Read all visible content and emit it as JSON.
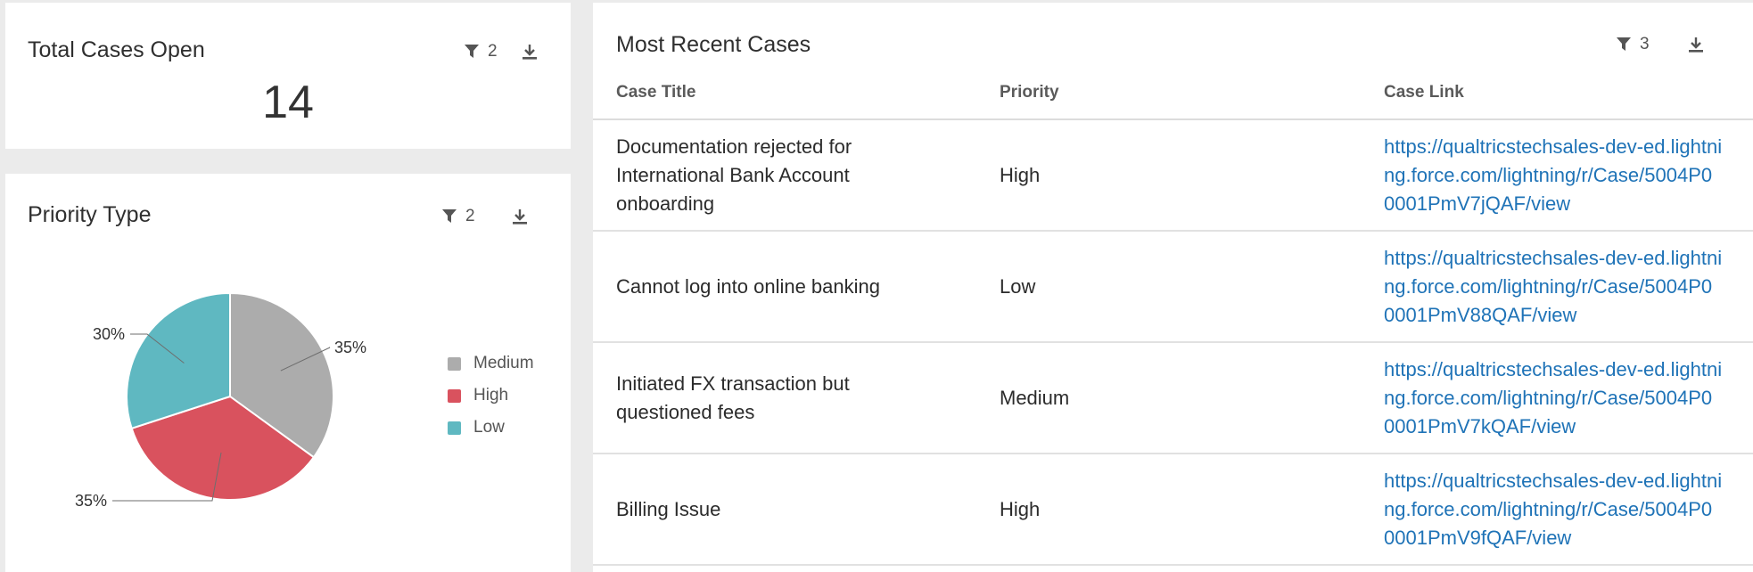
{
  "total_cases": {
    "title": "Total Cases Open",
    "filter_count": "2",
    "value": "14"
  },
  "priority_widget": {
    "title": "Priority Type",
    "filter_count": "2"
  },
  "chart_data": {
    "type": "pie",
    "title": "Priority Type",
    "slices": [
      {
        "label": "Medium",
        "value": 35,
        "display": "35%",
        "color": "#acacac"
      },
      {
        "label": "High",
        "value": 35,
        "display": "35%",
        "color": "#d9525e"
      },
      {
        "label": "Low",
        "value": 30,
        "display": "30%",
        "color": "#5fb8c1"
      }
    ],
    "legend": [
      "Medium",
      "High",
      "Low"
    ],
    "legend_position": "right"
  },
  "recent_cases": {
    "title": "Most Recent Cases",
    "filter_count": "3",
    "columns": [
      "Case Title",
      "Priority",
      "Case Link"
    ],
    "rows": [
      {
        "title": "Documentation rejected for International Bank Account onboarding",
        "priority": "High",
        "link": "https://qualtricstechsales-dev-ed.lightning.force.com/lightning/r/Case/5004P00001PmV7jQAF/view"
      },
      {
        "title": "Cannot log into online banking",
        "priority": "Low",
        "link": "https://qualtricstechsales-dev-ed.lightning.force.com/lightning/r/Case/5004P00001PmV88QAF/view"
      },
      {
        "title": "Initiated FX transaction but questioned fees",
        "priority": "Medium",
        "link": "https://qualtricstechsales-dev-ed.lightning.force.com/lightning/r/Case/5004P00001PmV7kQAF/view"
      },
      {
        "title": "Billing Issue",
        "priority": "High",
        "link": "https://qualtricstechsales-dev-ed.lightning.force.com/lightning/r/Case/5004P00001PmV9fQAF/view"
      }
    ]
  },
  "icons": {
    "filter": "filter-funnel-icon",
    "download": "download-icon"
  }
}
